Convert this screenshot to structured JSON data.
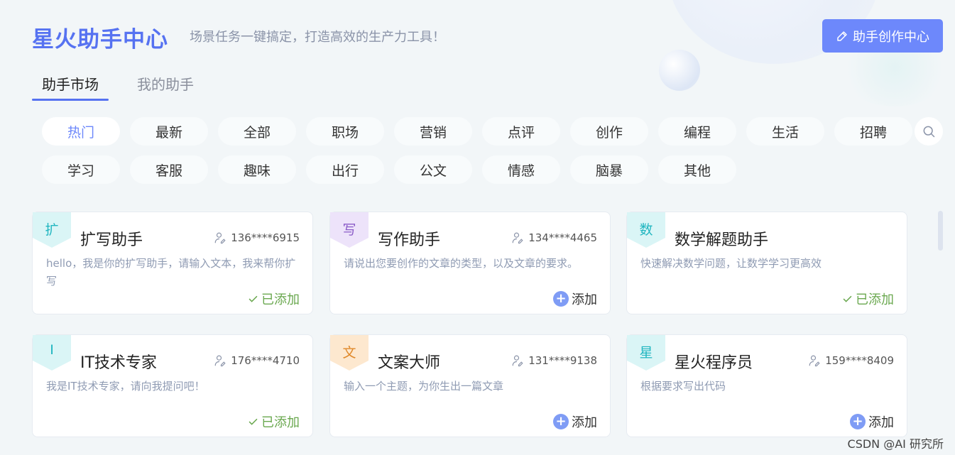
{
  "header": {
    "title": "星火助手中心",
    "subtitle": "场景任务一键搞定，打造高效的生产力工具！",
    "create_button": "助手创作中心"
  },
  "tabs": [
    {
      "label": "助手市场",
      "active": true
    },
    {
      "label": "我的助手",
      "active": false
    }
  ],
  "categories": {
    "row1": [
      "热门",
      "最新",
      "全部",
      "职场",
      "营销",
      "点评",
      "创作",
      "编程",
      "生活",
      "招聘"
    ],
    "row2": [
      "学习",
      "客服",
      "趣味",
      "出行",
      "公文",
      "情感",
      "脑暴",
      "其他"
    ],
    "selected": "热门"
  },
  "cards": [
    {
      "badge": "扩",
      "title": "扩写助手",
      "user": "136****6915",
      "desc": "hello，我是你的扩写助手，请输入文本，我来帮你扩写",
      "status": "已添加"
    },
    {
      "badge": "写",
      "title": "写作助手",
      "user": "134****4465",
      "desc": "请说出您要创作的文章的类型，以及文章的要求。",
      "status": "添加"
    },
    {
      "badge": "数",
      "title": "数学解题助手",
      "user": "",
      "desc": "快速解决数学问题，让数学学习更高效",
      "status": "已添加"
    },
    {
      "badge": "I",
      "title": "IT技术专家",
      "user": "176****4710",
      "desc": "我是IT技术专家，请向我提问吧！",
      "status": "已添加"
    },
    {
      "badge": "文",
      "title": "文案大师",
      "user": "131****9138",
      "desc": "输入一个主题，为你生出一篇文章",
      "status": "添加"
    },
    {
      "badge": "星",
      "title": "星火程序员",
      "user": "159****8409",
      "desc": "根据要求写出代码",
      "status": "添加"
    }
  ],
  "watermark": "CSDN @AI 研究所",
  "colors": {
    "accent": "#5672f1",
    "button": "#6d88fb",
    "added": "#6aa84f"
  }
}
